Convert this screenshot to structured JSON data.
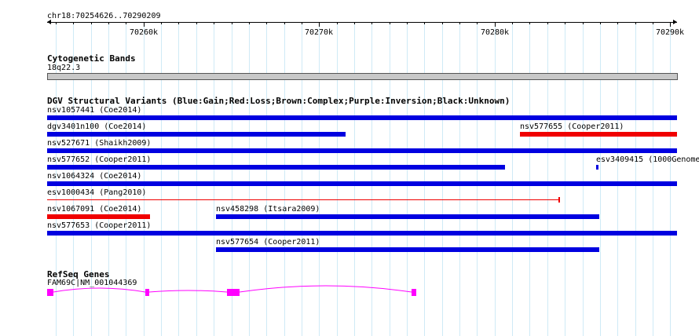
{
  "ruler": {
    "location": "chr18:70254626..70290209",
    "major_ticks": [
      "70260k",
      "70270k",
      "70280k",
      "70290k"
    ]
  },
  "cytoband": {
    "title": "Cytogenetic Bands",
    "band_label": "18q22.3"
  },
  "dgv": {
    "title": "DGV Structural Variants (Blue:Gain;Red:Loss;Brown:Complex;Purple:Inversion;Black:Unknown)",
    "colors": {
      "gain": "#0000e0",
      "loss": "#f00000"
    },
    "variants": [
      {
        "label": "nsv1057441 (Coe2014)",
        "type": "gain"
      },
      {
        "label": "dgv3401n100 (Coe2014)",
        "type": "gain"
      },
      {
        "label": "nsv577655 (Cooper2011)",
        "type": "loss"
      },
      {
        "label": "nsv527671 (Shaikh2009)",
        "type": "gain"
      },
      {
        "label": "nsv577652 (Cooper2011)",
        "type": "gain"
      },
      {
        "label": "esv3409415 (1000Genome",
        "type": "gain"
      },
      {
        "label": "nsv1064324 (Coe2014)",
        "type": "gain"
      },
      {
        "label": "esv1000434 (Pang2010)",
        "type": "loss"
      },
      {
        "label": "nsv1067091 (Coe2014)",
        "type": "loss"
      },
      {
        "label": "nsv458298 (Itsara2009)",
        "type": "gain"
      },
      {
        "label": "nsv577653 (Cooper2011)",
        "type": "gain"
      },
      {
        "label": "nsv577654 (Cooper2011)",
        "type": "gain"
      }
    ]
  },
  "refseq": {
    "title": "RefSeq Genes",
    "gene_label": "FAM69C|NM_001044369",
    "color": "#ff00ff"
  }
}
